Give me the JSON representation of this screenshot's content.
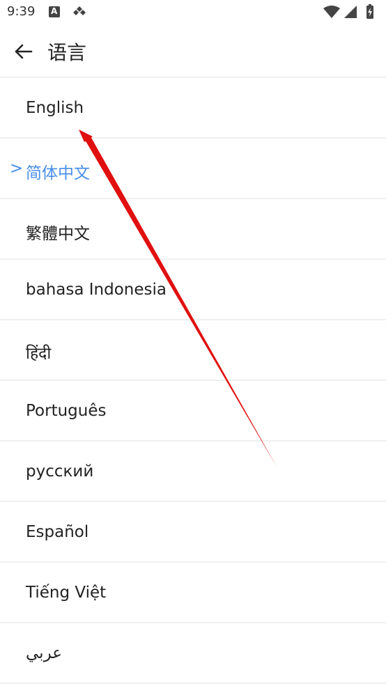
{
  "status_bar": {
    "time": "9:39"
  },
  "app_bar": {
    "title": "语言"
  },
  "languages": {
    "selected_marker": ">",
    "items": [
      {
        "label": "English"
      },
      {
        "label": "简体中文"
      },
      {
        "label": "繁體中文"
      },
      {
        "label": "bahasa Indonesia"
      },
      {
        "label": "हिंदी"
      },
      {
        "label": "Português"
      },
      {
        "label": "русский"
      },
      {
        "label": "Español"
      },
      {
        "label": "Tiếng Việt"
      },
      {
        "label": "عربي"
      }
    ]
  },
  "colors": {
    "accent": "#4a8fe8",
    "annotation": "#e01010",
    "divider": "#efefef"
  }
}
